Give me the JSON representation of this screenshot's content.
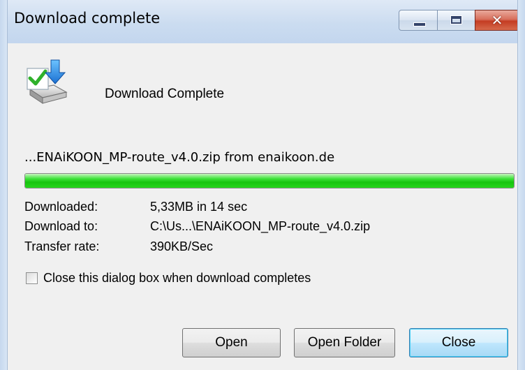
{
  "window": {
    "title": "Download complete",
    "close_glyph": "✕"
  },
  "header": {
    "icon": "download-complete-icon",
    "text": "Download Complete"
  },
  "download": {
    "file_line": "...ENAiKOON_MP-route_v4.0.zip from enaikoon.de",
    "progress_percent": 100,
    "rows": [
      {
        "label": "Downloaded:",
        "value": "5,33MB in 14 sec"
      },
      {
        "label": "Download to:",
        "value": "C:\\Us...\\ENAiKOON_MP-route_v4.0.zip"
      },
      {
        "label": "Transfer rate:",
        "value": "390KB/Sec"
      }
    ]
  },
  "options": {
    "close_when_done_label": "Close this dialog box when download completes",
    "close_when_done_checked": false
  },
  "buttons": {
    "open": "Open",
    "open_folder": "Open Folder",
    "close": "Close"
  },
  "colors": {
    "progress_green": "#17c40f",
    "accent_blue": "#3c7fb1",
    "close_red": "#c43c22"
  }
}
